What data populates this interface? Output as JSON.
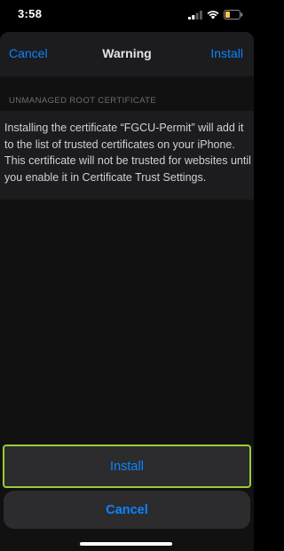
{
  "status_bar": {
    "time": "3:58",
    "icons": [
      "cellular-signal-icon",
      "wifi-icon",
      "battery-icon"
    ],
    "battery_color": "#f2c94c"
  },
  "nav": {
    "cancel_label": "Cancel",
    "title": "Warning",
    "install_label": "Install"
  },
  "section": {
    "header": "UNMANAGED ROOT CERTIFICATE",
    "message": "Installing the certificate “FGCU-Permit” will add it to the list of trusted certificates on your iPhone. This certificate will not be trusted for websites until you enable it in Certificate Trust Settings."
  },
  "action_sheet": {
    "install_label": "Install",
    "cancel_label": "Cancel"
  },
  "colors": {
    "accent": "#0a84ff",
    "background": "#000000",
    "surface": "#1c1c1e",
    "action_surface": "#2c2c2e",
    "highlight_border": "#9acd32"
  }
}
